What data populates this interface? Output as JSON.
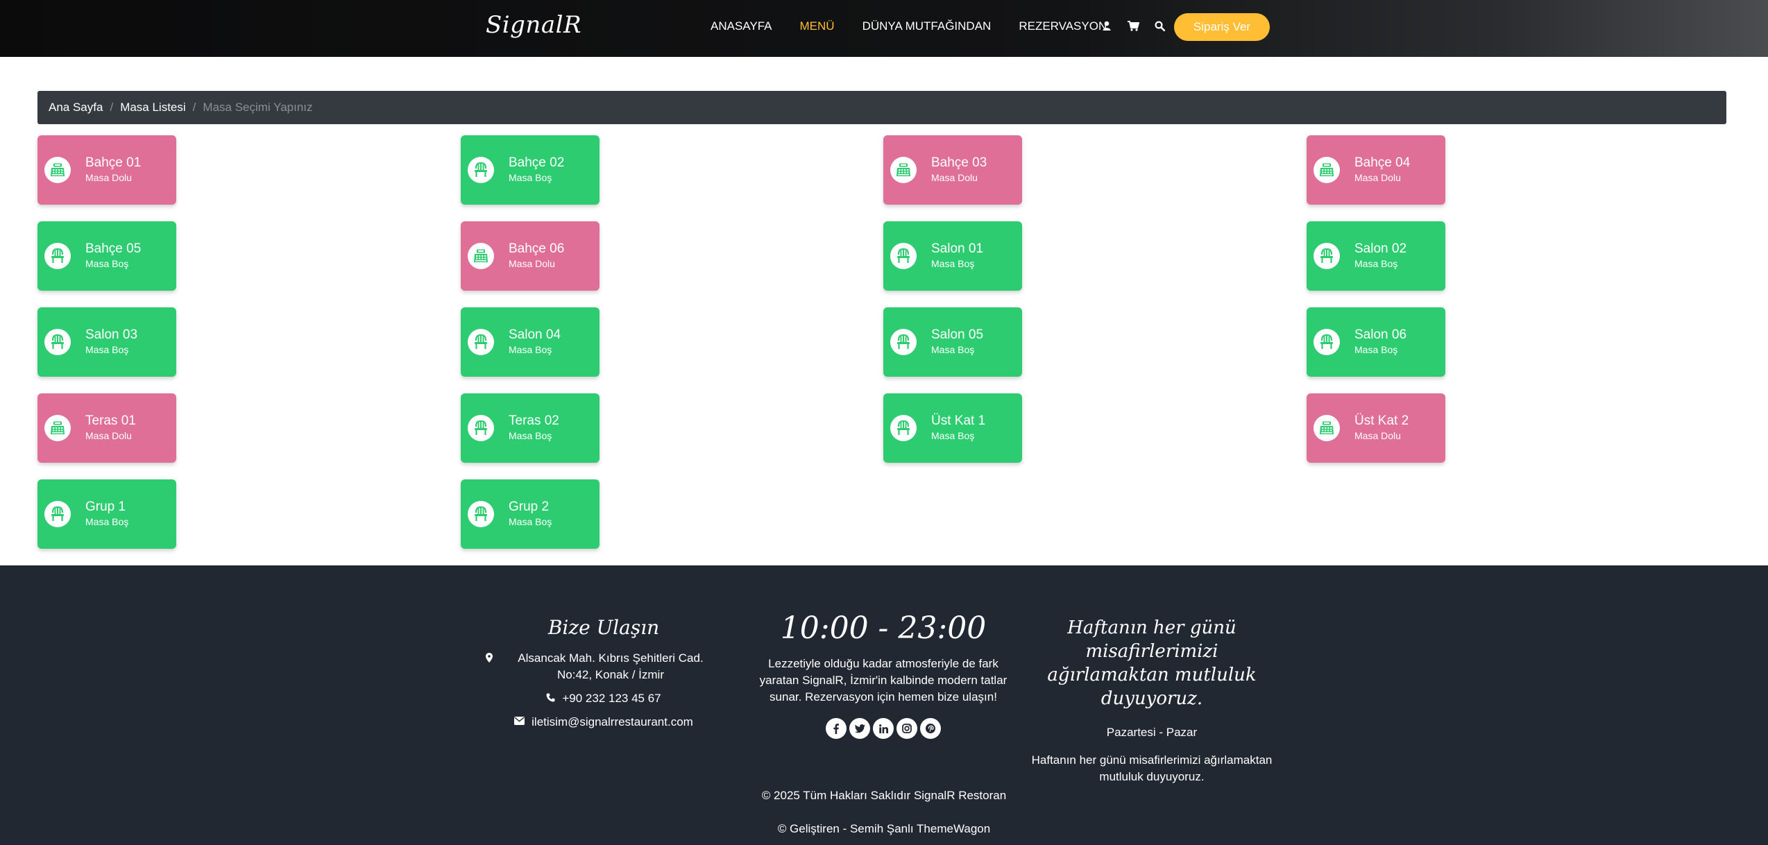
{
  "nav": {
    "brand": "SignalR",
    "links": [
      "ANASAYFA",
      "MENÜ",
      "DÜNYA MUTFAĞINDAN",
      "REZERVASYON"
    ],
    "active_index": 1,
    "order_button": "Sipariş Ver",
    "icons": [
      "user-icon",
      "cart-icon",
      "search-icon"
    ]
  },
  "breadcrumb": {
    "home": "Ana Sayfa",
    "list": "Masa Listesi",
    "current": "Masa Seçimi Yapınız"
  },
  "tables": [
    {
      "name": "Bahçe 01",
      "status": "Masa Dolu",
      "occupied": true
    },
    {
      "name": "Bahçe 02",
      "status": "Masa Boş",
      "occupied": false
    },
    {
      "name": "Bahçe 03",
      "status": "Masa Dolu",
      "occupied": true
    },
    {
      "name": "Bahçe 04",
      "status": "Masa Dolu",
      "occupied": true
    },
    {
      "name": "Bahçe 05",
      "status": "Masa Boş",
      "occupied": false
    },
    {
      "name": "Bahçe 06",
      "status": "Masa Dolu",
      "occupied": true
    },
    {
      "name": "Salon 01",
      "status": "Masa Boş",
      "occupied": false
    },
    {
      "name": "Salon 02",
      "status": "Masa Boş",
      "occupied": false
    },
    {
      "name": "Salon 03",
      "status": "Masa Boş",
      "occupied": false
    },
    {
      "name": "Salon 04",
      "status": "Masa Boş",
      "occupied": false
    },
    {
      "name": "Salon 05",
      "status": "Masa Boş",
      "occupied": false
    },
    {
      "name": "Salon 06",
      "status": "Masa Boş",
      "occupied": false
    },
    {
      "name": "Teras 01",
      "status": "Masa Dolu",
      "occupied": true
    },
    {
      "name": "Teras 02",
      "status": "Masa Boş",
      "occupied": false
    },
    {
      "name": "Üst Kat 1",
      "status": "Masa Boş",
      "occupied": false
    },
    {
      "name": "Üst Kat 2",
      "status": "Masa Dolu",
      "occupied": true
    },
    {
      "name": "Grup 1",
      "status": "Masa Boş",
      "occupied": false
    },
    {
      "name": "Grup 2",
      "status": "Masa Boş",
      "occupied": false
    }
  ],
  "footer": {
    "contact_title": "Bize Ulaşın",
    "address": "Alsancak Mah. Kıbrıs Şehitleri Cad. No:42, Konak / İzmir",
    "phone": "+90 232 123 45 67",
    "email": "iletisim@signalrrestaurant.com",
    "hours": "10:00 - 23:00",
    "about": "Lezzetiyle olduğu kadar atmosferiyle de fark yaratan SignalR, İzmir'in kalbinde modern tatlar sunar. Rezervasyon için hemen bize ulaşın!",
    "socials": [
      "facebook-icon",
      "twitter-icon",
      "linkedin-icon",
      "instagram-icon",
      "pinterest-icon"
    ],
    "welcome_title": "Haftanın her günü misafirlerimizi ağırlamaktan mutluluk duyuyoruz.",
    "days": "Pazartesi - Pazar",
    "welcome_text": "Haftanın her günü misafirlerimizi ağırlamaktan mutluluk duyuyoruz.",
    "copyright": "© 2025 Tüm Hakları Saklıdır SignalR Restoran",
    "credit": "© Geliştiren - Semih Şanlı ThemeWagon"
  },
  "colors": {
    "accent": "#ffbe33",
    "table_full": "#df6f96",
    "table_empty": "#2ecc71",
    "footer_bg": "#222831",
    "breadcrumb_bg": "#343a40"
  }
}
